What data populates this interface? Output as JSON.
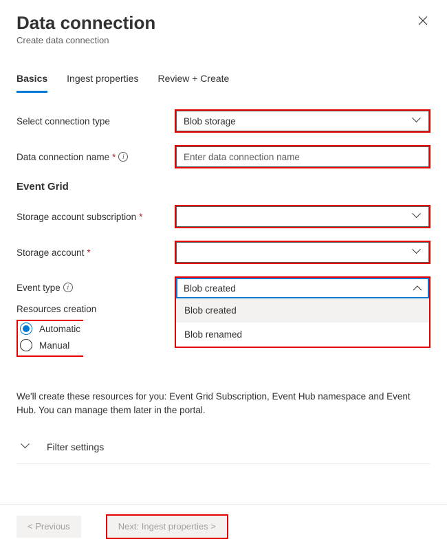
{
  "header": {
    "title": "Data connection",
    "subtitle": "Create data connection"
  },
  "tabs": {
    "basics": "Basics",
    "ingest": "Ingest properties",
    "review": "Review + Create"
  },
  "form": {
    "connection_type": {
      "label": "Select connection type",
      "value": "Blob storage"
    },
    "connection_name": {
      "label": "Data connection name",
      "placeholder": "Enter data connection name",
      "value": ""
    },
    "event_grid_heading": "Event Grid",
    "storage_subscription": {
      "label": "Storage account subscription",
      "value": ""
    },
    "storage_account": {
      "label": "Storage account",
      "value": ""
    },
    "event_type": {
      "label": "Event type",
      "value": "Blob created",
      "options": [
        "Blob created",
        "Blob renamed"
      ]
    },
    "resources_creation": {
      "label": "Resources creation",
      "options": {
        "automatic": "Automatic",
        "manual": "Manual"
      },
      "selected": "automatic"
    },
    "description": "We'll create these resources for you: Event Grid Subscription, Event Hub namespace and Event Hub. You can manage them later in the portal.",
    "filter_settings": "Filter settings"
  },
  "footer": {
    "previous": "< Previous",
    "next": "Next: Ingest properties >"
  }
}
